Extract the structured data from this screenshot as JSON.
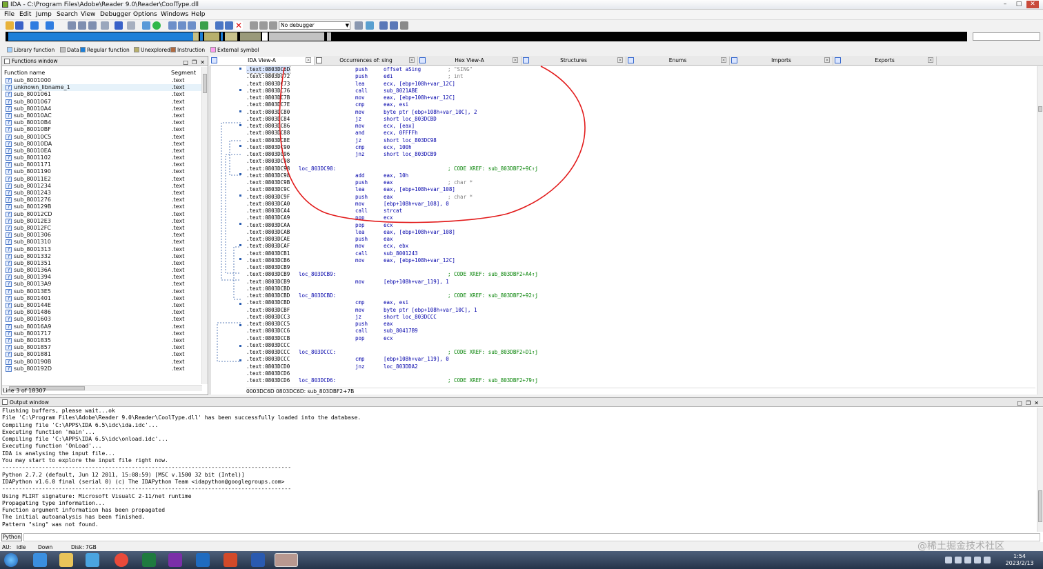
{
  "window": {
    "title": "IDA - C:\\Program Files\\Adobe\\Reader 9.0\\Reader\\CoolType.dll"
  },
  "menu": [
    "File",
    "Edit",
    "Jump",
    "Search",
    "View",
    "Debugger",
    "Options",
    "Windows",
    "Help"
  ],
  "toolbar": {
    "debugger_select": "No debugger"
  },
  "legend": [
    {
      "label": "Library function",
      "color": "#a0d0ff"
    },
    {
      "label": "Data",
      "color": "#c0c0c0"
    },
    {
      "label": "Regular function",
      "color": "#1c7fd8"
    },
    {
      "label": "Unexplored",
      "color": "#b8b06c"
    },
    {
      "label": "Instruction",
      "color": "#b06a40"
    },
    {
      "label": "External symbol",
      "color": "#ff9cf0"
    }
  ],
  "tabs": [
    "IDA View-A",
    "Occurrences of: sing",
    "Hex View-A",
    "Structures",
    "Enums",
    "Imports",
    "Exports"
  ],
  "functions_window": {
    "title": "Functions window",
    "col_name": "Function name",
    "col_segment": "Segment",
    "rows": [
      {
        "name": "sub_8001000",
        "seg": ".text"
      },
      {
        "name": "unknown_libname_1",
        "seg": ".text"
      },
      {
        "name": "sub_8001061",
        "seg": ".text"
      },
      {
        "name": "sub_8001067",
        "seg": ".text"
      },
      {
        "name": "sub_80010A4",
        "seg": ".text"
      },
      {
        "name": "sub_80010AC",
        "seg": ".text"
      },
      {
        "name": "sub_80010B4",
        "seg": ".text"
      },
      {
        "name": "sub_80010BF",
        "seg": ".text"
      },
      {
        "name": "sub_80010C5",
        "seg": ".text"
      },
      {
        "name": "sub_80010DA",
        "seg": ".text"
      },
      {
        "name": "sub_80010EA",
        "seg": ".text"
      },
      {
        "name": "sub_8001102",
        "seg": ".text"
      },
      {
        "name": "sub_8001171",
        "seg": ".text"
      },
      {
        "name": "sub_8001190",
        "seg": ".text"
      },
      {
        "name": "sub_80011E2",
        "seg": ".text"
      },
      {
        "name": "sub_8001234",
        "seg": ".text"
      },
      {
        "name": "sub_8001243",
        "seg": ".text"
      },
      {
        "name": "sub_8001276",
        "seg": ".text"
      },
      {
        "name": "sub_800129B",
        "seg": ".text"
      },
      {
        "name": "sub_80012CD",
        "seg": ".text"
      },
      {
        "name": "sub_80012E3",
        "seg": ".text"
      },
      {
        "name": "sub_80012FC",
        "seg": ".text"
      },
      {
        "name": "sub_8001306",
        "seg": ".text"
      },
      {
        "name": "sub_8001310",
        "seg": ".text"
      },
      {
        "name": "sub_8001313",
        "seg": ".text"
      },
      {
        "name": "sub_8001332",
        "seg": ".text"
      },
      {
        "name": "sub_8001351",
        "seg": ".text"
      },
      {
        "name": "sub_800136A",
        "seg": ".text"
      },
      {
        "name": "sub_8001394",
        "seg": ".text"
      },
      {
        "name": "sub_80013A9",
        "seg": ".text"
      },
      {
        "name": "sub_80013E5",
        "seg": ".text"
      },
      {
        "name": "sub_8001401",
        "seg": ".text"
      },
      {
        "name": "sub_800144E",
        "seg": ".text"
      },
      {
        "name": "sub_8001486",
        "seg": ".text"
      },
      {
        "name": "sub_8001603",
        "seg": ".text"
      },
      {
        "name": "sub_80016A9",
        "seg": ".text"
      },
      {
        "name": "sub_8001717",
        "seg": ".text"
      },
      {
        "name": "sub_8001835",
        "seg": ".text"
      },
      {
        "name": "sub_8001857",
        "seg": ".text"
      },
      {
        "name": "sub_8001881",
        "seg": ".text"
      },
      {
        "name": "sub_800190B",
        "seg": ".text"
      },
      {
        "name": "sub_800192D",
        "seg": ".text"
      }
    ],
    "line_count": "Line 3 of 18307"
  },
  "ida_view": {
    "lines": [
      {
        "addr": ".text:0803DC6D",
        "label": "",
        "mnem": "push",
        "ops": "offset aSing",
        "cmt": "; \"SING\"",
        "xref": ""
      },
      {
        "addr": ".text:0803DC72",
        "label": "",
        "mnem": "push",
        "ops": "edi",
        "cmt": "; int",
        "xref": ""
      },
      {
        "addr": ".text:0803DC73",
        "label": "",
        "mnem": "lea",
        "ops": "ecx, [ebp+108h+var_12C]",
        "cmt": "",
        "xref": ""
      },
      {
        "addr": ".text:0803DC76",
        "label": "",
        "mnem": "call",
        "ops": "sub_8021ABE",
        "cmt": "",
        "xref": ""
      },
      {
        "addr": ".text:0803DC7B",
        "label": "",
        "mnem": "mov",
        "ops": "eax, [ebp+108h+var_12C]",
        "cmt": "",
        "xref": ""
      },
      {
        "addr": ".text:0803DC7E",
        "label": "",
        "mnem": "cmp",
        "ops": "eax, esi",
        "cmt": "",
        "xref": ""
      },
      {
        "addr": ".text:0803DC80",
        "label": "",
        "mnem": "mov",
        "ops": "byte ptr [ebp+108h+var_10C], 2",
        "cmt": "",
        "xref": ""
      },
      {
        "addr": ".text:0803DC84",
        "label": "",
        "mnem": "jz",
        "ops": "short loc_803DCBD",
        "cmt": "",
        "xref": ""
      },
      {
        "addr": ".text:0803DC86",
        "label": "",
        "mnem": "mov",
        "ops": "ecx, [eax]",
        "cmt": "",
        "xref": ""
      },
      {
        "addr": ".text:0803DC88",
        "label": "",
        "mnem": "and",
        "ops": "ecx, 0FFFFh",
        "cmt": "",
        "xref": ""
      },
      {
        "addr": ".text:0803DC8E",
        "label": "",
        "mnem": "jz",
        "ops": "short loc_803DC98",
        "cmt": "",
        "xref": ""
      },
      {
        "addr": ".text:0803DC90",
        "label": "",
        "mnem": "cmp",
        "ops": "ecx, 100h",
        "cmt": "",
        "xref": ""
      },
      {
        "addr": ".text:0803DC96",
        "label": "",
        "mnem": "jnz",
        "ops": "short loc_803DCB9",
        "cmt": "",
        "xref": ""
      },
      {
        "addr": ".text:0803DC98",
        "label": "",
        "mnem": "",
        "ops": "",
        "cmt": "",
        "xref": ""
      },
      {
        "addr": ".text:0803DC98",
        "label": "loc_803DC98:",
        "mnem": "",
        "ops": "",
        "cmt": "",
        "xref": "; CODE XREF: sub_803DBF2+9C↑j"
      },
      {
        "addr": ".text:0803DC98",
        "label": "",
        "mnem": "add",
        "ops": "eax, 10h",
        "cmt": "",
        "xref": ""
      },
      {
        "addr": ".text:0803DC9B",
        "label": "",
        "mnem": "push",
        "ops": "eax",
        "cmt": "; char *",
        "xref": ""
      },
      {
        "addr": ".text:0803DC9C",
        "label": "",
        "mnem": "lea",
        "ops": "eax, [ebp+108h+var_108]",
        "cmt": "",
        "xref": ""
      },
      {
        "addr": ".text:0803DC9F",
        "label": "",
        "mnem": "push",
        "ops": "eax",
        "cmt": "; char *",
        "xref": ""
      },
      {
        "addr": ".text:0803DCA0",
        "label": "",
        "mnem": "mov",
        "ops": "[ebp+108h+var_108], 0",
        "cmt": "",
        "xref": ""
      },
      {
        "addr": ".text:0803DCA4",
        "label": "",
        "mnem": "call",
        "ops": "strcat",
        "cmt": "",
        "xref": ""
      },
      {
        "addr": ".text:0803DCA9",
        "label": "",
        "mnem": "pop",
        "ops": "ecx",
        "cmt": "",
        "xref": ""
      },
      {
        "addr": ".text:0803DCAA",
        "label": "",
        "mnem": "pop",
        "ops": "ecx",
        "cmt": "",
        "xref": ""
      },
      {
        "addr": ".text:0803DCAB",
        "label": "",
        "mnem": "lea",
        "ops": "eax, [ebp+108h+var_108]",
        "cmt": "",
        "xref": ""
      },
      {
        "addr": ".text:0803DCAE",
        "label": "",
        "mnem": "push",
        "ops": "eax",
        "cmt": "",
        "xref": ""
      },
      {
        "addr": ".text:0803DCAF",
        "label": "",
        "mnem": "mov",
        "ops": "ecx, ebx",
        "cmt": "",
        "xref": ""
      },
      {
        "addr": ".text:0803DCB1",
        "label": "",
        "mnem": "call",
        "ops": "sub_8001243",
        "cmt": "",
        "xref": ""
      },
      {
        "addr": ".text:0803DCB6",
        "label": "",
        "mnem": "mov",
        "ops": "eax, [ebp+108h+var_12C]",
        "cmt": "",
        "xref": ""
      },
      {
        "addr": ".text:0803DCB9",
        "label": "",
        "mnem": "",
        "ops": "",
        "cmt": "",
        "xref": ""
      },
      {
        "addr": ".text:0803DCB9",
        "label": "loc_803DCB9:",
        "mnem": "",
        "ops": "",
        "cmt": "",
        "xref": "; CODE XREF: sub_803DBF2+A4↑j"
      },
      {
        "addr": ".text:0803DCB9",
        "label": "",
        "mnem": "mov",
        "ops": "[ebp+108h+var_119], 1",
        "cmt": "",
        "xref": ""
      },
      {
        "addr": ".text:0803DCBD",
        "label": "",
        "mnem": "",
        "ops": "",
        "cmt": "",
        "xref": ""
      },
      {
        "addr": ".text:0803DCBD",
        "label": "loc_803DCBD:",
        "mnem": "",
        "ops": "",
        "cmt": "",
        "xref": "; CODE XREF: sub_803DBF2+92↑j"
      },
      {
        "addr": ".text:0803DCBD",
        "label": "",
        "mnem": "cmp",
        "ops": "eax, esi",
        "cmt": "",
        "xref": ""
      },
      {
        "addr": ".text:0803DCBF",
        "label": "",
        "mnem": "mov",
        "ops": "byte ptr [ebp+108h+var_10C], 1",
        "cmt": "",
        "xref": ""
      },
      {
        "addr": ".text:0803DCC3",
        "label": "",
        "mnem": "jz",
        "ops": "short loc_803DCCC",
        "cmt": "",
        "xref": ""
      },
      {
        "addr": ".text:0803DCC5",
        "label": "",
        "mnem": "push",
        "ops": "eax",
        "cmt": "",
        "xref": ""
      },
      {
        "addr": ".text:0803DCC6",
        "label": "",
        "mnem": "call",
        "ops": "sub_80417B9",
        "cmt": "",
        "xref": ""
      },
      {
        "addr": ".text:0803DCCB",
        "label": "",
        "mnem": "pop",
        "ops": "ecx",
        "cmt": "",
        "xref": ""
      },
      {
        "addr": ".text:0803DCCC",
        "label": "",
        "mnem": "",
        "ops": "",
        "cmt": "",
        "xref": ""
      },
      {
        "addr": ".text:0803DCCC",
        "label": "loc_803DCCC:",
        "mnem": "",
        "ops": "",
        "cmt": "",
        "xref": "; CODE XREF: sub_803DBF2+D1↑j"
      },
      {
        "addr": ".text:0803DCCC",
        "label": "",
        "mnem": "cmp",
        "ops": "[ebp+108h+var_119], 0",
        "cmt": "",
        "xref": ""
      },
      {
        "addr": ".text:0803DCD0",
        "label": "",
        "mnem": "jnz",
        "ops": "loc_803DDA2",
        "cmt": "",
        "xref": ""
      },
      {
        "addr": ".text:0803DCD6",
        "label": "",
        "mnem": "",
        "ops": "",
        "cmt": "",
        "xref": ""
      },
      {
        "addr": ".text:0803DCD6",
        "label": "loc_803DCD6:",
        "mnem": "",
        "ops": "",
        "cmt": "",
        "xref": "; CODE XREF: sub_803DBF2+79↑j"
      }
    ],
    "status": "0003DC6D 0803DC6D: sub_803DBF2+7B"
  },
  "output_window": {
    "title": "Output window",
    "lines": [
      "Flushing buffers, please wait...ok",
      "File 'C:\\Program Files\\Adobe\\Reader 9.0\\Reader\\CoolType.dll' has been successfully loaded into the database.",
      "Compiling file 'C:\\APPS\\IDA 6.5\\idc\\ida.idc'...",
      "Executing function 'main'...",
      "Compiling file 'C:\\APPS\\IDA 6.5\\idc\\onload.idc'...",
      "Executing function 'OnLoad'...",
      "IDA is analysing the input file...",
      "You may start to explore the input file right now.",
      "---------------------------------------------------------------------------------------",
      "Python 2.7.2 (default, Jun 12 2011, 15:08:59) [MSC v.1500 32 bit (Intel)]",
      "IDAPython v1.6.0 final (serial 0) (c) The IDAPython Team <idapython@googlegroups.com>",
      "---------------------------------------------------------------------------------------",
      "Using FLIRT signature: Microsoft VisualC 2-11/net runtime",
      "Propagating type information...",
      "Function argument information has been propagated",
      "The initial autoanalysis has been finished.",
      "Pattern \"sing\" was not found."
    ],
    "python_button": "Python"
  },
  "statusbar": {
    "au": "AU:",
    "state": "idle",
    "direction": "Down",
    "disk": "Disk: 7GB"
  },
  "taskbar": {
    "time": "1:54",
    "date": "2023/2/13"
  },
  "watermark": "@稀土掘金技术社区"
}
